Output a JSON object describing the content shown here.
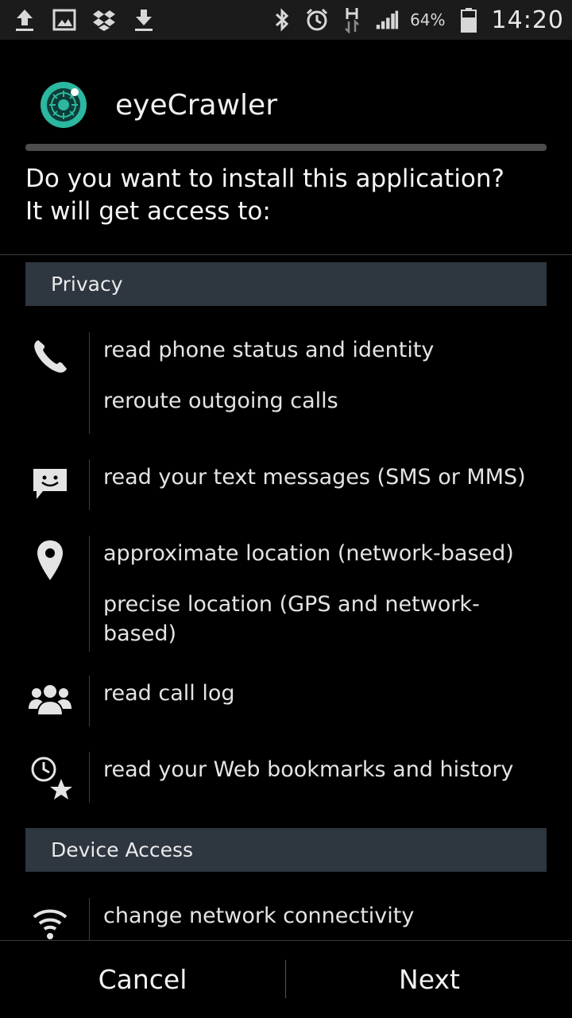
{
  "status_bar": {
    "left_icons": [
      "upload-icon",
      "image-icon",
      "dropbox-icon",
      "download-icon"
    ],
    "right_icons": [
      "bluetooth-icon",
      "alarm-icon",
      "hspa-icon",
      "signal-icon"
    ],
    "battery_text": "64%",
    "time": "14:20"
  },
  "app": {
    "name": "eyeCrawler",
    "icon": "eye-app-icon",
    "accent_color": "#2bb7a0"
  },
  "install_prompt": {
    "line1": "Do you want to install this application?",
    "line2": "It will get access to:"
  },
  "sections": {
    "privacy": "Privacy",
    "device_access": "Device Access"
  },
  "permissions": {
    "phone": {
      "icon": "phone-icon",
      "lines": [
        "read phone status and identity",
        "reroute outgoing calls"
      ]
    },
    "messages": {
      "icon": "message-icon",
      "lines": [
        "read your text messages (SMS or MMS)"
      ]
    },
    "location": {
      "icon": "location-pin-icon",
      "lines": [
        "approximate location (network-based)",
        "precise location (GPS and network-based)"
      ]
    },
    "call_log": {
      "icon": "people-icon",
      "lines": [
        "read call log"
      ]
    },
    "bookmarks": {
      "icon": "clock-star-icon",
      "lines": [
        "read your Web bookmarks and history"
      ]
    },
    "network": {
      "icon": "wifi-icon",
      "lines": [
        "change network connectivity"
      ]
    }
  },
  "buttons": {
    "cancel": "Cancel",
    "next": "Next"
  }
}
